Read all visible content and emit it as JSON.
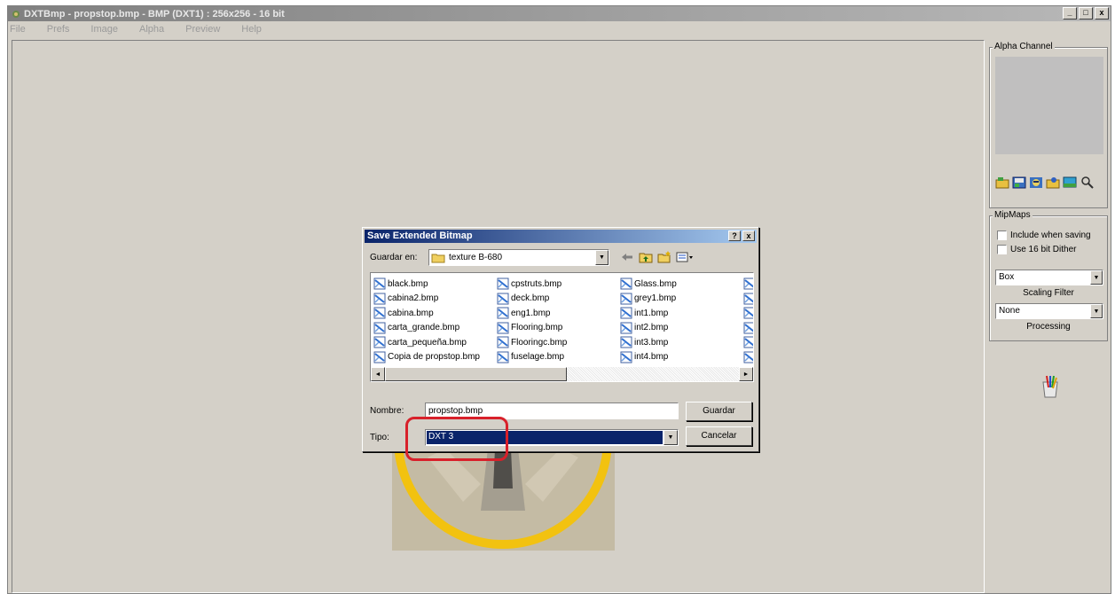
{
  "window": {
    "title": "DXTBmp - propstop.bmp - BMP (DXT1) : 256x256 - 16 bit",
    "controls": [
      "_",
      "□",
      "x"
    ]
  },
  "menu": [
    "File",
    "Prefs",
    "Image",
    "Alpha",
    "Preview",
    "Help"
  ],
  "right_panel": {
    "alpha_channel_title": "Alpha Channel",
    "mipmaps_title": "MipMaps",
    "include_when_saving": "Include when saving",
    "use_16bit_dither": "Use 16 bit Dither",
    "scaling_filter_value": "Box",
    "scaling_filter_caption": "Scaling Filter",
    "processing_value": "None",
    "processing_caption": "Processing"
  },
  "dialog": {
    "title": "Save Extended Bitmap",
    "help_button": "?",
    "close_button": "x",
    "look_in_label": "Guardar en:",
    "look_in_value": "texture B-680",
    "files_col1": [
      "black.bmp",
      "cabina2.bmp",
      "cabina.bmp",
      "carta_grande.bmp",
      "carta_pequeña.bmp",
      "Copia de propstop.bmp"
    ],
    "files_col2": [
      "cpstruts.bmp",
      "deck.bmp",
      "eng1.bmp",
      "Flooring.bmp",
      "Flooringc.bmp",
      "fuselage.bmp"
    ],
    "files_col3": [
      "Glass.bmp",
      "grey1.bmp",
      "int1.bmp",
      "int2.bmp",
      "int3.bmp",
      "int4.bmp"
    ],
    "name_label": "Nombre:",
    "name_value": "propstop.bmp",
    "type_label": "Tipo:",
    "type_value": "DXT 3",
    "save_button": "Guardar",
    "cancel_button": "Cancelar"
  },
  "colors": {
    "highlight_ring": "#d8202a",
    "dialog_title": "#0a246a",
    "preview_ring": "#f5c518"
  }
}
